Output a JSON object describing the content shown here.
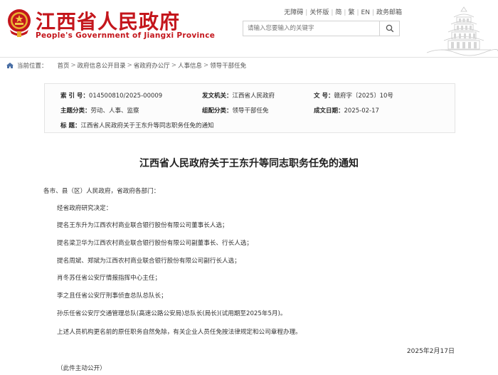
{
  "header": {
    "site_title": "江西省人民政府",
    "site_subtitle": "People's Government of Jiangxi Province",
    "top_links": [
      "无障碍",
      "关怀版",
      "简",
      "繁",
      "EN",
      "政务邮箱"
    ],
    "search_placeholder": "请输入您要输入的关键字"
  },
  "breadcrumb": {
    "label": "当前位置：",
    "items": [
      "首页",
      "政府信息公开目录",
      "省政府办公厅",
      "人事信息",
      "领导干部任免"
    ]
  },
  "meta": {
    "index_label": "索  引  号：",
    "index_value": "014500810/2025-00009",
    "issuer_label": "发文机关：",
    "issuer_value": "江西省人民政府",
    "docno_label": "文      号：",
    "docno_value": "赣府字〔2025〕10号",
    "subject_label": "主题分类：",
    "subject_value": "劳动、人事、监察",
    "category_label": "组配分类：",
    "category_value": "领导干部任免",
    "date_label": "成文日期：",
    "date_value": "2025-02-17",
    "title_label": "标      题：",
    "title_value": "江西省人民政府关于王东升等同志职务任免的通知"
  },
  "article": {
    "title": "江西省人民政府关于王东升等同志职务任免的通知",
    "greeting": "各市、县（区）人民政府，省政府各部门：",
    "paragraphs": [
      "经省政府研究决定：",
      "提名王东升为江西农村商业联合银行股份有限公司董事长人选；",
      "提名梁卫华为江西农村商业联合银行股份有限公司副董事长、行长人选；",
      "提名周斌、郑斌为江西农村商业联合银行股份有限公司副行长人选；",
      "肖冬苏任省公安厅情报指挥中心主任；",
      "李之且任省公安厅刑事侦查总队总队长；",
      "孙乐任省公安厅交通管理总队(高速公路公安局)总队长(局长)(试用期至2025年5月)。",
      "上述人员机构更名前的原任职务自然免除，有关企业人员任免按法律规定和公司章程办理。"
    ],
    "date": "2025年2月17日",
    "note": "（此件主动公开）"
  }
}
